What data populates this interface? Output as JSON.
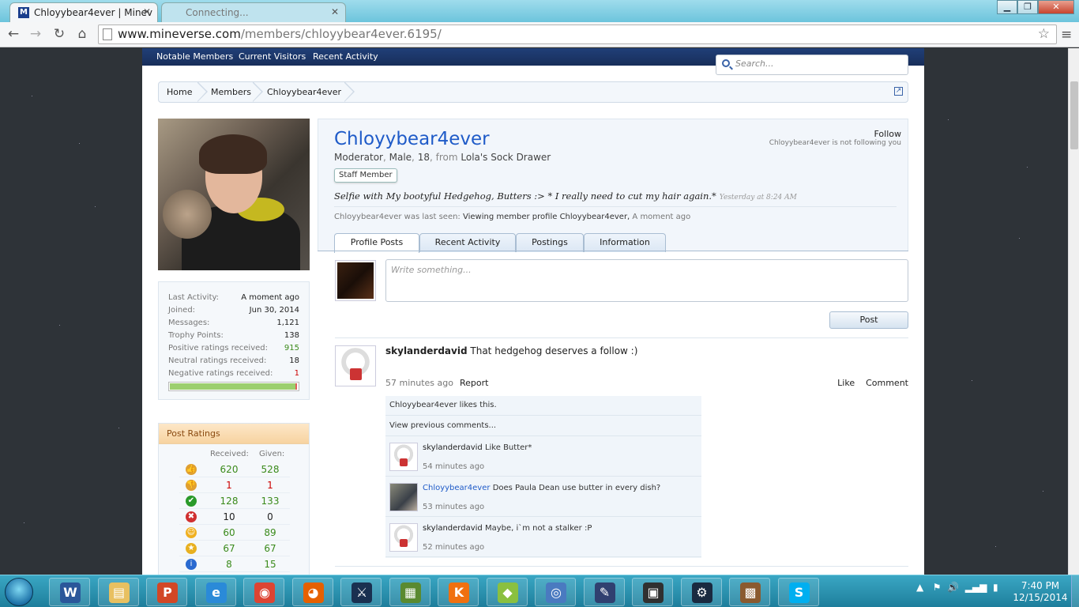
{
  "browser": {
    "tabs": [
      {
        "title": "Chloyybear4ever | Minev",
        "favicon": "M"
      },
      {
        "title": "Connecting..."
      }
    ],
    "url_host": "www.mineverse.com",
    "url_path": "/members/chloyybear4ever.6195/"
  },
  "site": {
    "nav": [
      "Notable Members",
      "Current Visitors",
      "Recent Activity"
    ],
    "search_placeholder": "Search...",
    "breadcrumb": [
      "Home",
      "Members",
      "Chloyybear4ever"
    ]
  },
  "profile": {
    "username": "Chloyybear4ever",
    "role": "Moderator",
    "gender": "Male",
    "age": "18",
    "from_label": "from",
    "location": "Lola's Sock Drawer",
    "badge": "Staff Member",
    "status": "Selfie with My bootyful Hedgehog, Butters :> * I really need to cut my hair again.*",
    "status_time": "Yesterday at 8:24 AM",
    "last_seen_label": "Chloyybear4ever was last seen:",
    "last_seen_activity": "Viewing member profile Chloyybear4ever,",
    "last_seen_time": "A moment ago",
    "follow": "Follow",
    "follow_state": "Chloyybear4ever is not following you",
    "tabs": [
      "Profile Posts",
      "Recent Activity",
      "Postings",
      "Information"
    ]
  },
  "stats": [
    {
      "label": "Last Activity:",
      "value": "A moment ago",
      "color": "normal"
    },
    {
      "label": "Joined:",
      "value": "Jun 30, 2014",
      "color": "normal"
    },
    {
      "label": "Messages:",
      "value": "1,121",
      "color": "normal"
    },
    {
      "label": "Trophy Points:",
      "value": "138",
      "color": "normal"
    },
    {
      "label": "Positive ratings received:",
      "value": "915",
      "color": "green"
    },
    {
      "label": "Neutral ratings received:",
      "value": "18",
      "color": "normal"
    },
    {
      "label": "Negative ratings received:",
      "value": "1",
      "color": "red"
    }
  ],
  "rating_ratio": 0.98,
  "post_ratings": {
    "title": "Post Ratings",
    "received_label": "Received:",
    "given_label": "Given:",
    "rows": [
      {
        "icon": "thumbs-up-icon",
        "color": "#e0a030",
        "glyph": "👍",
        "received": "620",
        "given": "528",
        "rcolor": "green",
        "gcolor": "green"
      },
      {
        "icon": "thumbs-down-icon",
        "color": "#e0a030",
        "glyph": "👎",
        "received": "1",
        "given": "1",
        "rcolor": "red",
        "gcolor": "red"
      },
      {
        "icon": "checkmark-icon",
        "color": "#2a9a2a",
        "glyph": "✔",
        "received": "128",
        "given": "133",
        "rcolor": "green",
        "gcolor": "green"
      },
      {
        "icon": "cross-icon",
        "color": "#d03030",
        "glyph": "✖",
        "received": "10",
        "given": "0",
        "rcolor": "black",
        "gcolor": "black"
      },
      {
        "icon": "smiley-icon",
        "color": "#f0b020",
        "glyph": "☺",
        "received": "60",
        "given": "89",
        "rcolor": "green",
        "gcolor": "green"
      },
      {
        "icon": "star-icon",
        "color": "#e8b020",
        "glyph": "★",
        "received": "67",
        "given": "67",
        "rcolor": "green",
        "gcolor": "green"
      },
      {
        "icon": "info-icon",
        "color": "#2a6ad0",
        "glyph": "i",
        "received": "8",
        "given": "15",
        "rcolor": "green",
        "gcolor": "green"
      }
    ]
  },
  "composer": {
    "placeholder": "Write something...",
    "post_button": "Post"
  },
  "post": {
    "author": "skylanderdavid",
    "text": "That hedgehog deserves a follow :)",
    "time": "57 minutes ago",
    "report": "Report",
    "like": "Like",
    "comment": "Comment",
    "likes_text": "Chloyybear4ever likes this.",
    "view_previous": "View previous comments...",
    "comments": [
      {
        "author": "skylanderdavid",
        "text": "Like Butter*",
        "time": "54 minutes ago",
        "blue": false
      },
      {
        "author": "Chloyybear4ever",
        "text": "Does Paula Dean use butter in every dish?",
        "time": "53 minutes ago",
        "blue": true
      },
      {
        "author": "skylanderdavid",
        "text": "Maybe, i`m not a stalker :P",
        "time": "52 minutes ago",
        "blue": false
      }
    ]
  },
  "taskbar": {
    "apps": [
      {
        "name": "word-icon",
        "glyph": "W",
        "color": "#2b579a"
      },
      {
        "name": "explorer-icon",
        "glyph": "▤",
        "color": "#e8c060"
      },
      {
        "name": "powerpoint-icon",
        "glyph": "P",
        "color": "#d24726"
      },
      {
        "name": "internet-explorer-icon",
        "glyph": "e",
        "color": "#2a8ad8"
      },
      {
        "name": "chrome-icon",
        "glyph": "◉",
        "color": "#dd4433"
      },
      {
        "name": "firefox-icon",
        "glyph": "◕",
        "color": "#e66000"
      },
      {
        "name": "app-icon",
        "glyph": "⚔",
        "color": "#1a3050"
      },
      {
        "name": "minecraft-icon",
        "glyph": "▦",
        "color": "#5a8a30"
      },
      {
        "name": "k-icon",
        "glyph": "K",
        "color": "#f07010"
      },
      {
        "name": "folder-icon",
        "glyph": "◆",
        "color": "#8ac040"
      },
      {
        "name": "network-icon",
        "glyph": "◎",
        "color": "#4a7ac0"
      },
      {
        "name": "pen-icon",
        "glyph": "✎",
        "color": "#304070"
      },
      {
        "name": "camera-icon",
        "glyph": "▣",
        "color": "#303030"
      },
      {
        "name": "steam-icon",
        "glyph": "⚙",
        "color": "#1a2a40"
      },
      {
        "name": "crafting-table-icon",
        "glyph": "▩",
        "color": "#8a5a30"
      },
      {
        "name": "skype-icon",
        "glyph": "S",
        "color": "#00aff0"
      }
    ],
    "time": "7:40 PM",
    "date": "12/15/2014"
  }
}
